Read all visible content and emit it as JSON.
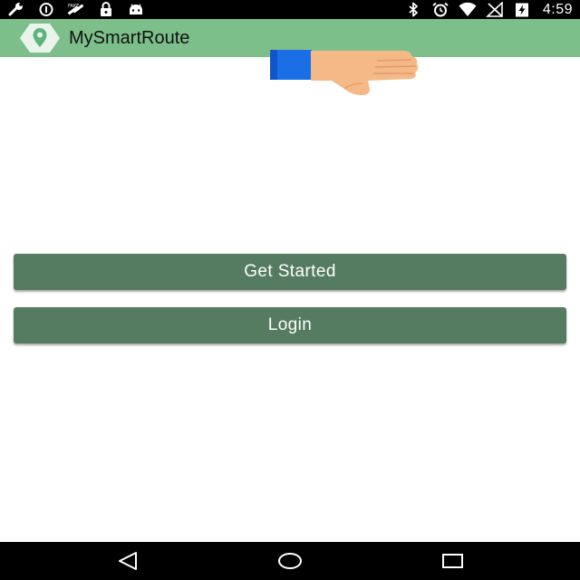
{
  "status_bar": {
    "time": "4:59",
    "left_icons": [
      "wrench-icon",
      "circle-info-icon",
      "satellite-fake-gps-icon",
      "lock-icon",
      "android-robot-icon"
    ],
    "right_icons": [
      "bluetooth-icon",
      "alarm-icon",
      "wifi-icon",
      "signal-off-icon",
      "battery-charging-icon"
    ]
  },
  "app_bar": {
    "title": "MySmartRoute",
    "logo_icon": "map-pin-hexagon-icon",
    "color": "#7dbf8b"
  },
  "overlay": {
    "icon": "thumbs-down-hand-icon"
  },
  "buttons": {
    "get_started_label": "Get Started",
    "login_label": "Login",
    "color": "#557c60"
  },
  "nav_bar": {
    "back_icon": "back-triangle-icon",
    "home_icon": "home-circle-icon",
    "recents_icon": "recents-square-icon"
  }
}
